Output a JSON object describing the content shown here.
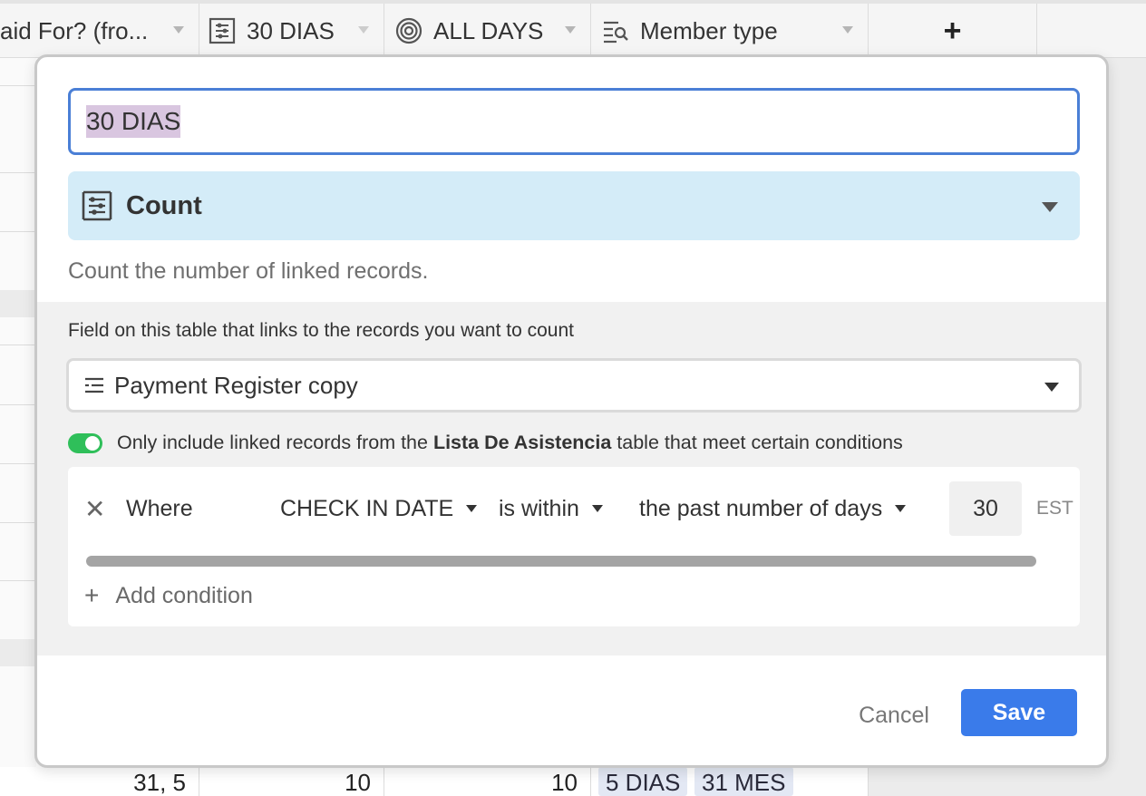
{
  "grid": {
    "columns": [
      {
        "label": "aid For? (fro...",
        "icon": "lookup-icon"
      },
      {
        "label": "30 DIAS",
        "icon": "count-icon"
      },
      {
        "label": "ALL DAYS",
        "icon": "rollup-icon"
      },
      {
        "label": "Member type",
        "icon": "search-lookup-icon"
      }
    ],
    "add_column_label": "+",
    "bottom_row": {
      "cell1": "31, 5",
      "cell2": "10",
      "cell3": "10",
      "pill1": "5 DIAS",
      "pill2": "31 MES"
    }
  },
  "dialog": {
    "field_name": "30 DIAS",
    "field_type": "Count",
    "field_type_icon": "count-icon",
    "field_type_description": "Count the number of linked records.",
    "link_field_label": "Field on this table that links to the records you want to count",
    "link_field_value": "Payment Register copy",
    "filter_toggle_on": true,
    "filter_text_prefix": "Only include linked records from the ",
    "filter_table": "Lista De Asistencia",
    "filter_text_suffix": " table that meet certain conditions",
    "condition": {
      "where_label": "Where",
      "field": "CHECK IN DATE",
      "operator": "is within",
      "mode": "the past number of days",
      "value": "30",
      "timezone": "EST"
    },
    "add_condition_label": "Add condition",
    "cancel_label": "Cancel",
    "save_label": "Save",
    "colors": {
      "accent": "#3a7bea",
      "type_bg": "#d4ecf8",
      "toggle_on": "#2fbf5a",
      "selection": "#d9c6e0"
    }
  }
}
